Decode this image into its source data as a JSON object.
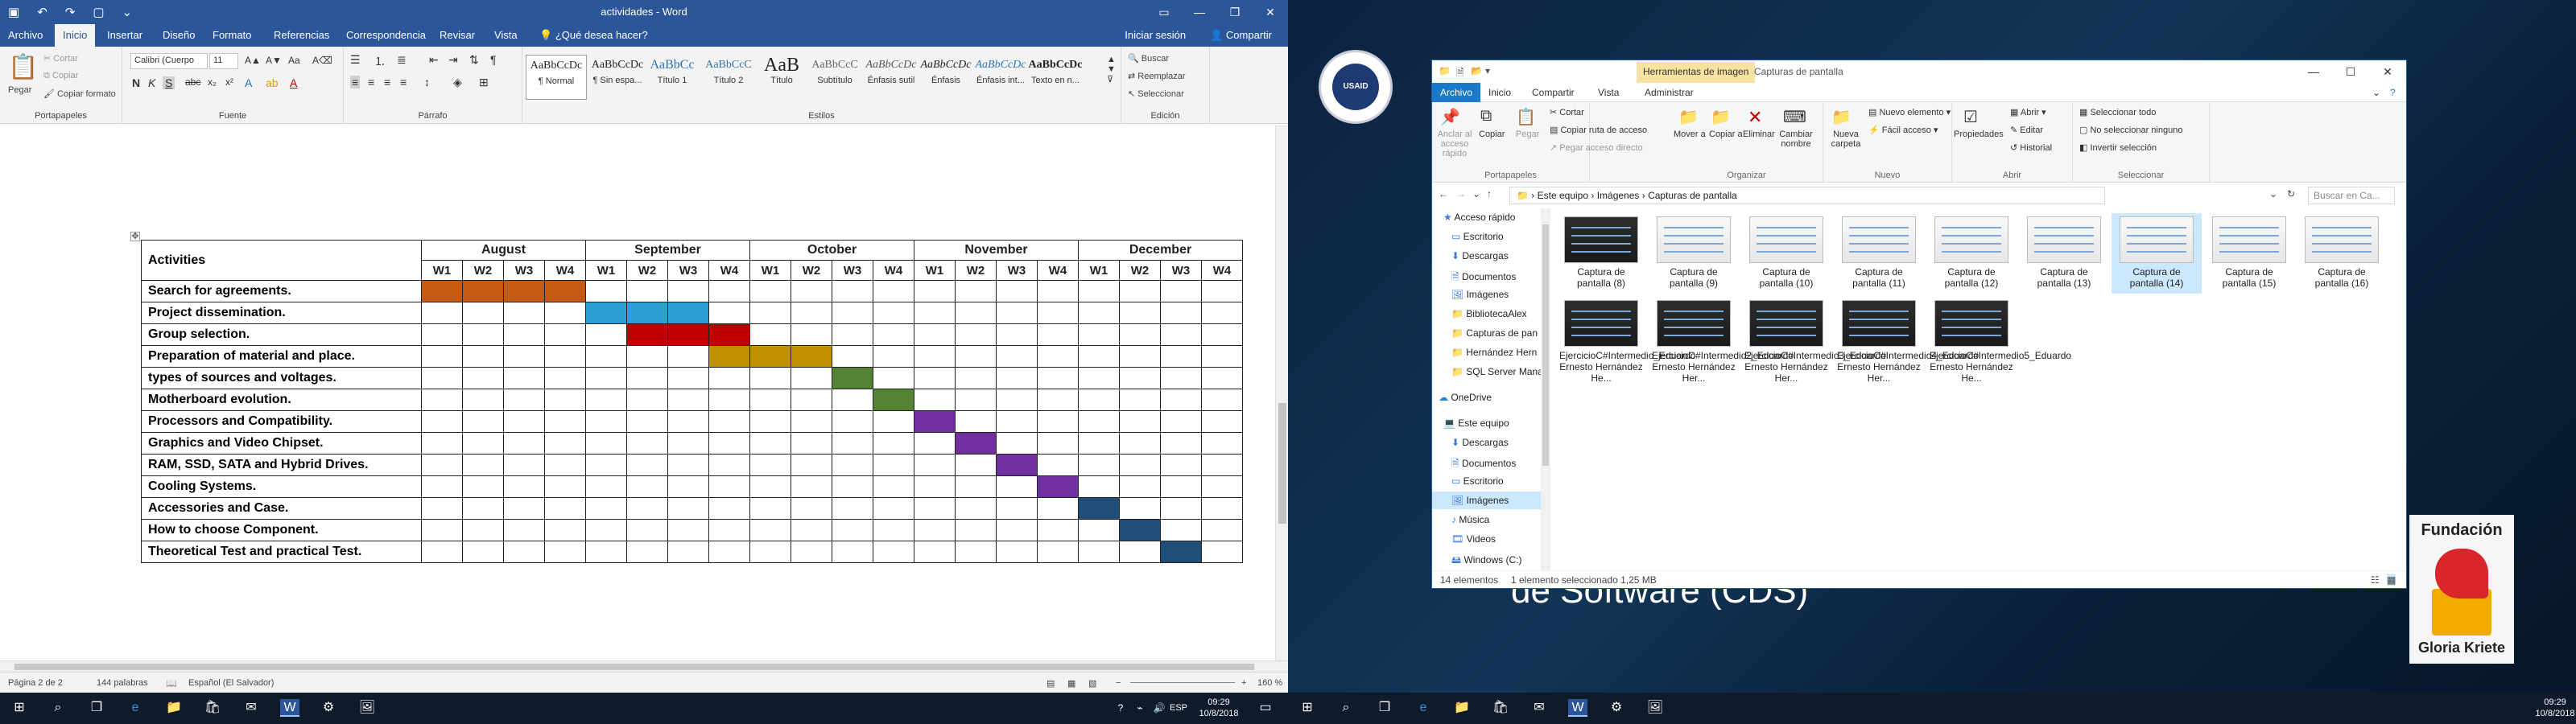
{
  "word": {
    "title": "actividades - Word",
    "tabs": [
      "Archivo",
      "Inicio",
      "Insertar",
      "Diseño",
      "Formato",
      "Referencias",
      "Correspondencia",
      "Revisar",
      "Vista"
    ],
    "tell_me": "¿Qué desea hacer?",
    "sign_in": "Iniciar sesión",
    "share": "Compartir",
    "clipboard": {
      "paste": "Pegar",
      "cut": "Cortar",
      "copy": "Copiar",
      "format_painter": "Copiar formato",
      "label": "Portapapeles"
    },
    "font": {
      "name": "Calibri (Cuerpo",
      "size": "11",
      "label": "Fuente"
    },
    "paragraph_label": "Párrafo",
    "styles": {
      "items": [
        {
          "preview": "AaBbCcDc",
          "name": "¶ Normal"
        },
        {
          "preview": "AaBbCcDc",
          "name": "¶ Sin espa..."
        },
        {
          "preview": "AaBbCc",
          "name": "Título 1"
        },
        {
          "preview": "AaBbCcC",
          "name": "Título 2"
        },
        {
          "preview": "AaB",
          "name": "Título"
        },
        {
          "preview": "AaBbCcC",
          "name": "Subtítulo"
        },
        {
          "preview": "AaBbCcDc",
          "name": "Énfasis sutil"
        },
        {
          "preview": "AaBbCcDc",
          "name": "Énfasis"
        },
        {
          "preview": "AaBbCcDc",
          "name": "Énfasis int..."
        },
        {
          "preview": "AaBbCcDc",
          "name": "Texto en n..."
        }
      ],
      "label": "Estilos"
    },
    "editing": {
      "find": "Buscar",
      "replace": "Reemplazar",
      "select": "Seleccionar",
      "label": "Edición"
    },
    "status": {
      "page": "Página 2 de 2",
      "words": "144 palabras",
      "language": "Español (El Salvador)",
      "zoom": "160 %"
    }
  },
  "gantt": {
    "header": "Activities",
    "months": [
      "August",
      "September",
      "October",
      "November",
      "December"
    ],
    "weeks": [
      "W1",
      "W2",
      "W3",
      "W4"
    ],
    "colors": {
      "orange": "#c55a11",
      "blue": "#2e9fd4",
      "red": "#c00000",
      "gold": "#bf8f00",
      "green": "#548235",
      "purple": "#7030a0",
      "navy": "#1f4e79"
    },
    "rows": [
      {
        "name": "Search for agreements.",
        "cells": [
          0,
          1,
          2,
          3
        ],
        "color": "#c55a11"
      },
      {
        "name": "Project dissemination.",
        "cells": [
          4,
          5,
          6
        ],
        "color": "#2e9fd4"
      },
      {
        "name": "Group selection.",
        "cells": [
          5,
          6,
          7
        ],
        "color": "#c00000"
      },
      {
        "name": "Preparation of material and place.",
        "cells": [
          7,
          8,
          9
        ],
        "color": "#bf8f00"
      },
      {
        "name": "types of sources and voltages.",
        "cells": [
          10
        ],
        "color": "#548235"
      },
      {
        "name": "Motherboard evolution.",
        "cells": [
          11
        ],
        "color": "#548235"
      },
      {
        "name": "Processors and Compatibility.",
        "cells": [
          12
        ],
        "color": "#7030a0"
      },
      {
        "name": "Graphics and Video Chipset.",
        "cells": [
          13
        ],
        "color": "#7030a0"
      },
      {
        "name": "RAM, SSD, SATA and Hybrid Drives.",
        "cells": [
          14
        ],
        "color": "#7030a0"
      },
      {
        "name": "Cooling Systems.",
        "cells": [
          15
        ],
        "color": "#7030a0"
      },
      {
        "name": "Accessories and Case.",
        "cells": [
          16
        ],
        "color": "#1f4e79"
      },
      {
        "name": "How to choose Component.",
        "cells": [
          17
        ],
        "color": "#1f4e79"
      },
      {
        "name": "Theoretical Test and practical Test.",
        "cells": [
          18
        ],
        "color": "#1f4e79"
      }
    ]
  },
  "desktop": {
    "big_text": "de Software (CDS)",
    "fundacion": "Fundación",
    "gloria": "Gloria Kriete"
  },
  "explorer": {
    "tool_context": "Herramientas de imagen",
    "title": "Capturas de pantalla",
    "tabs": [
      "Archivo",
      "Inicio",
      "Compartir",
      "Vista",
      "Administrar"
    ],
    "ribbon": {
      "pin": "Anclar al acceso rápido",
      "copy": "Copiar",
      "paste": "Pegar",
      "cut": "Cortar",
      "copy_path": "Copiar ruta de acceso",
      "paste_shortcut": "Pegar acceso directo",
      "clipboard_label": "Portapapeles",
      "move_to": "Mover a",
      "copy_to": "Copiar a",
      "delete": "Eliminar",
      "rename": "Cambiar nombre",
      "organize_label": "Organizar",
      "new_folder": "Nueva carpeta",
      "new_item": "Nuevo elemento",
      "easy_access": "Fácil acceso",
      "new_label": "Nuevo",
      "properties": "Propiedades",
      "open": "Abrir",
      "edit": "Editar",
      "history": "Historial",
      "open_label": "Abrir",
      "select_all": "Seleccionar todo",
      "select_none": "No seleccionar ninguno",
      "invert": "Invertir selección",
      "select_label": "Seleccionar"
    },
    "path": [
      "Este equipo",
      "Imágenes",
      "Capturas de pantalla"
    ],
    "search_placeholder": "Buscar en Ca...",
    "nav": [
      "Acceso rápido",
      "Escritorio",
      "Descargas",
      "Documentos",
      "Imágenes",
      "BibliotecaAlex",
      "Capturas de pan",
      "Hernández Hern",
      "SQL Server Mana",
      "OneDrive",
      "Este equipo",
      "Descargas",
      "Documentos",
      "Escritorio",
      "Imágenes",
      "Música",
      "Videos",
      "Windows (C:)"
    ],
    "files_row1": [
      "Captura de pantalla (8)",
      "Captura de pantalla (9)",
      "Captura de pantalla (10)",
      "Captura de pantalla (11)",
      "Captura de pantalla (12)",
      "Captura de pantalla (13)",
      "Captura de pantalla (14)",
      "Captura de pantalla (15)",
      "Captura de pantalla (16)"
    ],
    "files_row2": [
      "EjercicioC#Intermedio_Eduardo Ernesto Hernández He...",
      "EjercicioC#Intermedio2_Eduardo Ernesto Hernández Her...",
      "EjercicioC#Intermedio3_Eduardo Ernesto Hernández Her...",
      "EjercicioC#Intermedio4_Eduardo Ernesto Hernández Her...",
      "EjercicioC#Intermedio5_Eduardo Ernesto Hernández He..."
    ],
    "status_count": "14 elementos",
    "status_selected": "1 elemento seleccionado  1,25 MB"
  },
  "taskbar": {
    "time": "09:29",
    "date": "10/8/2018"
  }
}
